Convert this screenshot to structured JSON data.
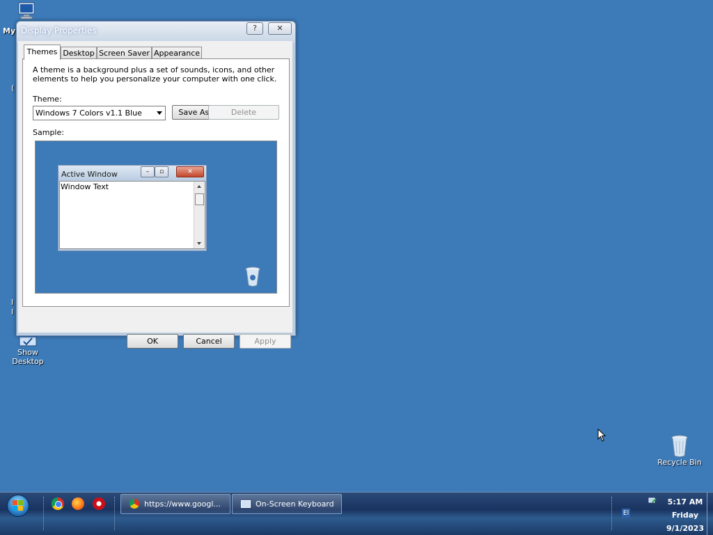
{
  "desktop": {
    "icons": {
      "my_computer": "My",
      "show_desktop": "Show\nDesktop",
      "recycle_bin": "Recycle Bin"
    },
    "edge_fragments": [
      "(",
      "I",
      "I"
    ]
  },
  "window": {
    "title": "Display Properties",
    "help_glyph": "?",
    "close_glyph": "✕",
    "tabs": [
      "Themes",
      "Desktop",
      "Screen Saver",
      "Appearance"
    ],
    "active_tab": "Themes",
    "description": "A theme is a background plus a set of sounds, icons, and other elements to help you personalize your computer with one click.",
    "theme_label": "Theme:",
    "theme_value": "Windows 7 Colors v1.1 Blue",
    "save_as_label": "Save As...",
    "delete_label": "Delete",
    "sample_label": "Sample:",
    "sample_window_title": "Active Window",
    "sample_window_text": "Window Text",
    "ok_label": "OK",
    "cancel_label": "Cancel",
    "apply_label": "Apply"
  },
  "taskbar": {
    "tasks": [
      "https://www.googl...",
      "On-Screen Keyboard"
    ],
    "language": "El",
    "clock": {
      "time": "5:17 AM",
      "day": "Friday",
      "date": "9/1/2023"
    }
  },
  "colors": {
    "desktop": "#3c7ab8",
    "taskbar": "#1a3360"
  }
}
